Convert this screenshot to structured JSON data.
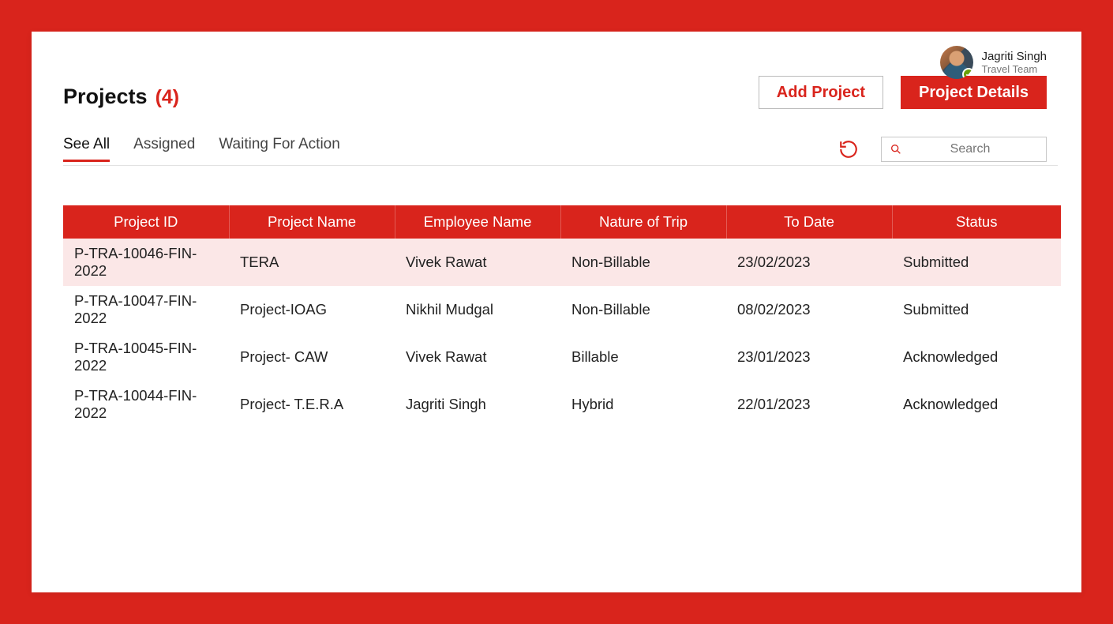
{
  "user": {
    "name": "Jagriti Singh",
    "role": "Travel Team"
  },
  "title": "Projects",
  "count": "(4)",
  "buttons": {
    "add": "Add Project",
    "details": "Project Details"
  },
  "tabs": {
    "seeAll": "See All",
    "assigned": "Assigned",
    "waiting": "Waiting For Action"
  },
  "search": {
    "placeholder": "Search"
  },
  "columns": {
    "id": "Project ID",
    "name": "Project Name",
    "emp": "Employee Name",
    "nat": "Nature of Trip",
    "date": "To Date",
    "status": "Status"
  },
  "rows": [
    {
      "id": "P-TRA-10046-FIN-2022",
      "name": "TERA",
      "emp": "Vivek Rawat",
      "nat": "Non-Billable",
      "date": "23/02/2023",
      "status": "Submitted",
      "hl": true
    },
    {
      "id": "P-TRA-10047-FIN-2022",
      "name": "Project-IOAG",
      "emp": "Nikhil Mudgal",
      "nat": "Non-Billable",
      "date": "08/02/2023",
      "status": "Submitted",
      "hl": false
    },
    {
      "id": "P-TRA-10045-FIN-2022",
      "name": "Project- CAW",
      "emp": "Vivek Rawat",
      "nat": "Billable",
      "date": "23/01/2023",
      "status": "Acknowledged",
      "hl": false
    },
    {
      "id": "P-TRA-10044-FIN-2022",
      "name": "Project- T.E.R.A",
      "emp": "Jagriti Singh",
      "nat": "Hybrid",
      "date": "22/01/2023",
      "status": "Acknowledged",
      "hl": false
    }
  ]
}
